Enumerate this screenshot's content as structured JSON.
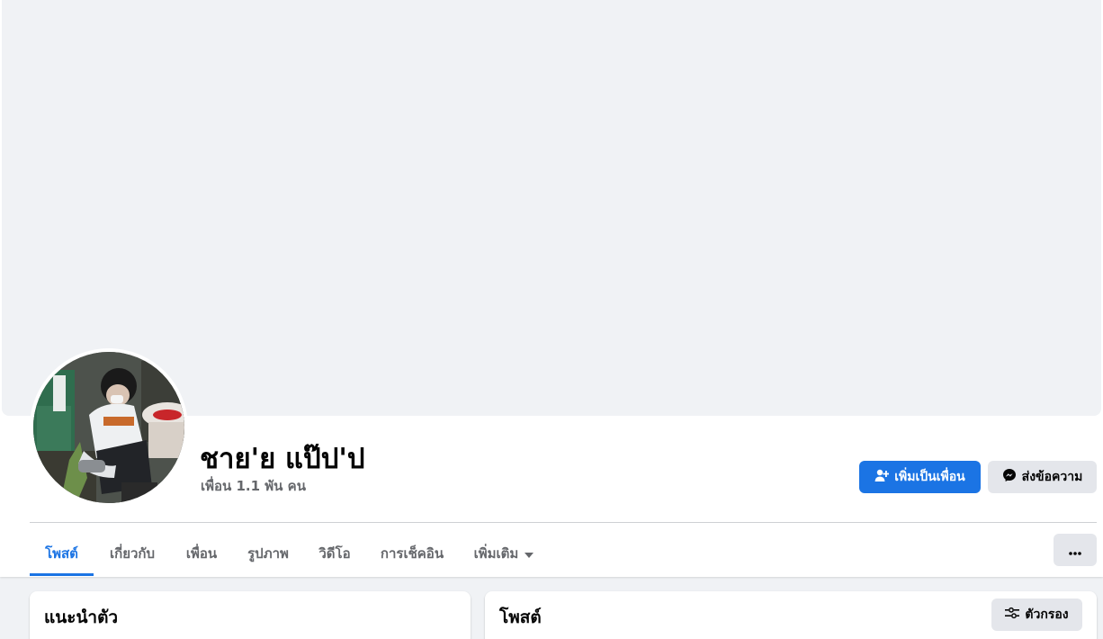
{
  "profile": {
    "name": "ชาย'ย แป๊ป'ป",
    "friend_count_text": "เพื่อน 1.1 พัน คน"
  },
  "actions": {
    "add_friend_label": "เพิ่มเป็นเพื่อน",
    "add_friend_icon": "add-friend-icon",
    "message_label": "ส่งข้อความ",
    "message_icon": "messenger-icon",
    "more_icon": "more-options-icon"
  },
  "tabs": [
    {
      "label": "โพสต์",
      "active": true
    },
    {
      "label": "เกี่ยวกับ",
      "active": false
    },
    {
      "label": "เพื่อน",
      "active": false
    },
    {
      "label": "รูปภาพ",
      "active": false
    },
    {
      "label": "วิดีโอ",
      "active": false
    },
    {
      "label": "การเช็คอิน",
      "active": false
    },
    {
      "label": "เพิ่มเติม",
      "active": false,
      "icon": "caret-down-icon"
    }
  ],
  "intro_card": {
    "title": "แนะนำตัว"
  },
  "posts_card": {
    "title": "โพสต์",
    "filter_label": "ตัวกรอง",
    "filter_icon": "filter-icon"
  },
  "colors": {
    "accent": "#1b74e4",
    "page_background": "#f0f2f5",
    "secondary_button": "#e4e6eb",
    "muted_text": "#65676b"
  }
}
